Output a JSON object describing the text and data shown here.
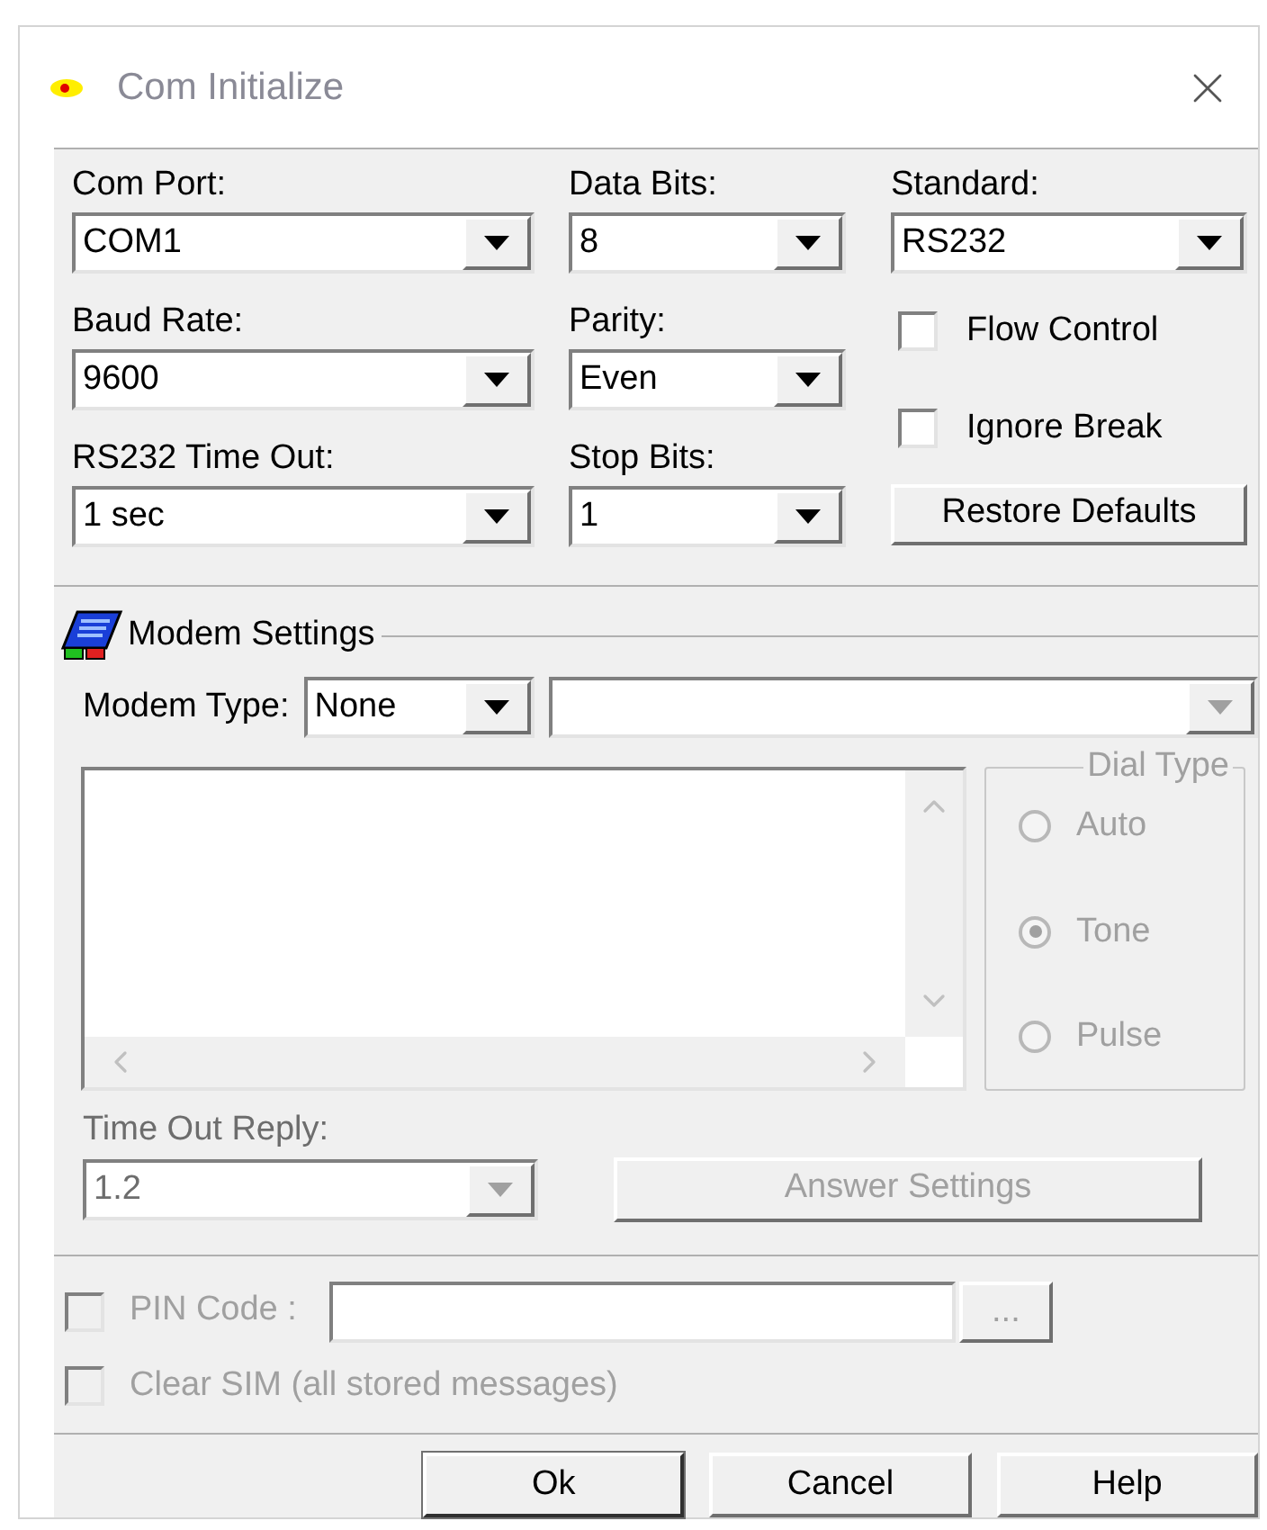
{
  "window": {
    "title": "Com Initialize"
  },
  "port_columns": [
    [
      {
        "label": "Com Port:",
        "value": "COM1"
      },
      {
        "label": "Baud Rate:",
        "value": "9600"
      },
      {
        "label": "RS232 Time Out:",
        "value": "1 sec"
      }
    ],
    [
      {
        "label": "Data Bits:",
        "value": "8"
      },
      {
        "label": "Parity:",
        "value": "Even"
      },
      {
        "label": "Stop Bits:",
        "value": "1"
      }
    ]
  ],
  "standard": {
    "label": "Standard:",
    "value": "RS232"
  },
  "options": [
    {
      "label": "Flow Control",
      "checked": false
    },
    {
      "label": "Ignore Break",
      "checked": false
    }
  ],
  "restore_button": "Restore Defaults",
  "modem": {
    "title": "Modem Settings",
    "type_label": "Modem Type:",
    "type_value": "None"
  },
  "dial_type": {
    "title": "Dial Type",
    "disabled": true,
    "options": [
      {
        "label": "Auto",
        "selected": false
      },
      {
        "label": "Tone",
        "selected": true
      },
      {
        "label": "Pulse",
        "selected": false
      }
    ]
  },
  "time_out_reply": {
    "label": "Time Out Reply:",
    "value": "1.2",
    "disabled": true
  },
  "answer_button": {
    "label": "Answer Settings",
    "disabled": true
  },
  "pin_code": {
    "label": "PIN Code :",
    "checked": false,
    "disabled": true,
    "browse": "..."
  },
  "clear_sim": {
    "label": "Clear SIM (all stored messages)",
    "checked": false,
    "disabled": true
  },
  "buttons": [
    {
      "label": "Ok",
      "default": true
    },
    {
      "label": "Cancel",
      "default": false
    },
    {
      "label": "Help",
      "default": false
    }
  ]
}
